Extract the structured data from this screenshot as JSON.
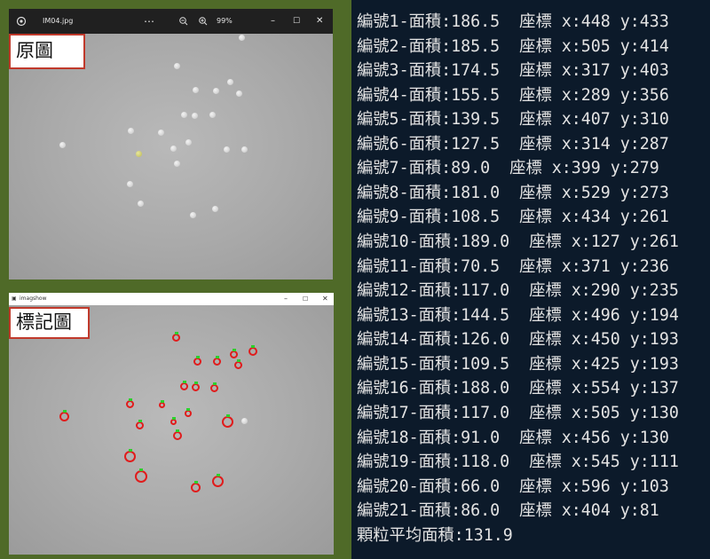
{
  "photo_viewer": {
    "filename": "IM04.jpg",
    "more_icon": "ellipsis-icon",
    "zoom_out_icon": "zoom-out-icon",
    "zoom_in_icon": "zoom-in-icon",
    "zoom_level": "99%",
    "caption": "原圖"
  },
  "imagshow": {
    "title": "imagshow",
    "caption": "標記圖"
  },
  "colors": {
    "background": "#4f6a28",
    "caption_border": "#c0392b",
    "marker_circle": "#e01c1c",
    "marker_tick": "#2bd12b",
    "terminal_bg": "#0c1a2a"
  },
  "terminal": {
    "particles": [
      {
        "text": "編號1-面積:186.5  座標 x:448 y:433"
      },
      {
        "text": "編號2-面積:185.5  座標 x:505 y:414"
      },
      {
        "text": "編號3-面積:174.5  座標 x:317 y:403"
      },
      {
        "text": "編號4-面積:155.5  座標 x:289 y:356"
      },
      {
        "text": "編號5-面積:139.5  座標 x:407 y:310"
      },
      {
        "text": "編號6-面積:127.5  座標 x:314 y:287"
      },
      {
        "text": "編號7-面積:89.0  座標 x:399 y:279"
      },
      {
        "text": "編號8-面積:181.0  座標 x:529 y:273"
      },
      {
        "text": "編號9-面積:108.5  座標 x:434 y:261"
      },
      {
        "text": "編號10-面積:189.0  座標 x:127 y:261"
      },
      {
        "text": "編號11-面積:70.5  座標 x:371 y:236"
      },
      {
        "text": "編號12-面積:117.0  座標 x:290 y:235"
      },
      {
        "text": "編號13-面積:144.5  座標 x:496 y:194"
      },
      {
        "text": "編號14-面積:126.0  座標 x:450 y:193"
      },
      {
        "text": "編號15-面積:109.5  座標 x:425 y:193"
      },
      {
        "text": "編號16-面積:188.0  座標 x:554 y:137"
      },
      {
        "text": "編號17-面積:117.0  座標 x:505 y:130"
      },
      {
        "text": "編號18-面積:91.0  座標 x:456 y:130"
      },
      {
        "text": "編號19-面積:118.0  座標 x:545 y:111"
      },
      {
        "text": "編號20-面積:66.0  座標 x:596 y:103"
      },
      {
        "text": "編號21-面積:86.0  座標 x:404 y:81"
      }
    ],
    "summary": "顆粒平均面積:131.9"
  }
}
